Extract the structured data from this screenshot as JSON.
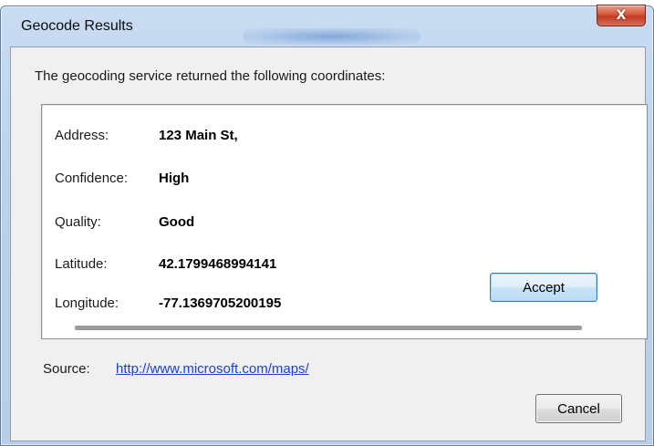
{
  "window": {
    "title": "Geocode Results",
    "close_glyph": "X"
  },
  "intro_text": "The geocoding service returned the following coordinates:",
  "results": {
    "address": {
      "label": "Address:",
      "value": "123 Main St,"
    },
    "confidence": {
      "label": "Confidence:",
      "value": "High"
    },
    "quality": {
      "label": "Quality:",
      "value": "Good"
    },
    "latitude": {
      "label": "Latitude:",
      "value": "42.1799468994141"
    },
    "longitude": {
      "label": "Longitude:",
      "value": "-77.1369705200195"
    }
  },
  "buttons": {
    "accept": "Accept",
    "cancel": "Cancel"
  },
  "source": {
    "label": "Source:",
    "link": "http://www.microsoft.com/maps/"
  },
  "colors": {
    "link": "#1a3fd6",
    "close_button": "#c13c22",
    "accept_border": "#3c7fb1"
  }
}
